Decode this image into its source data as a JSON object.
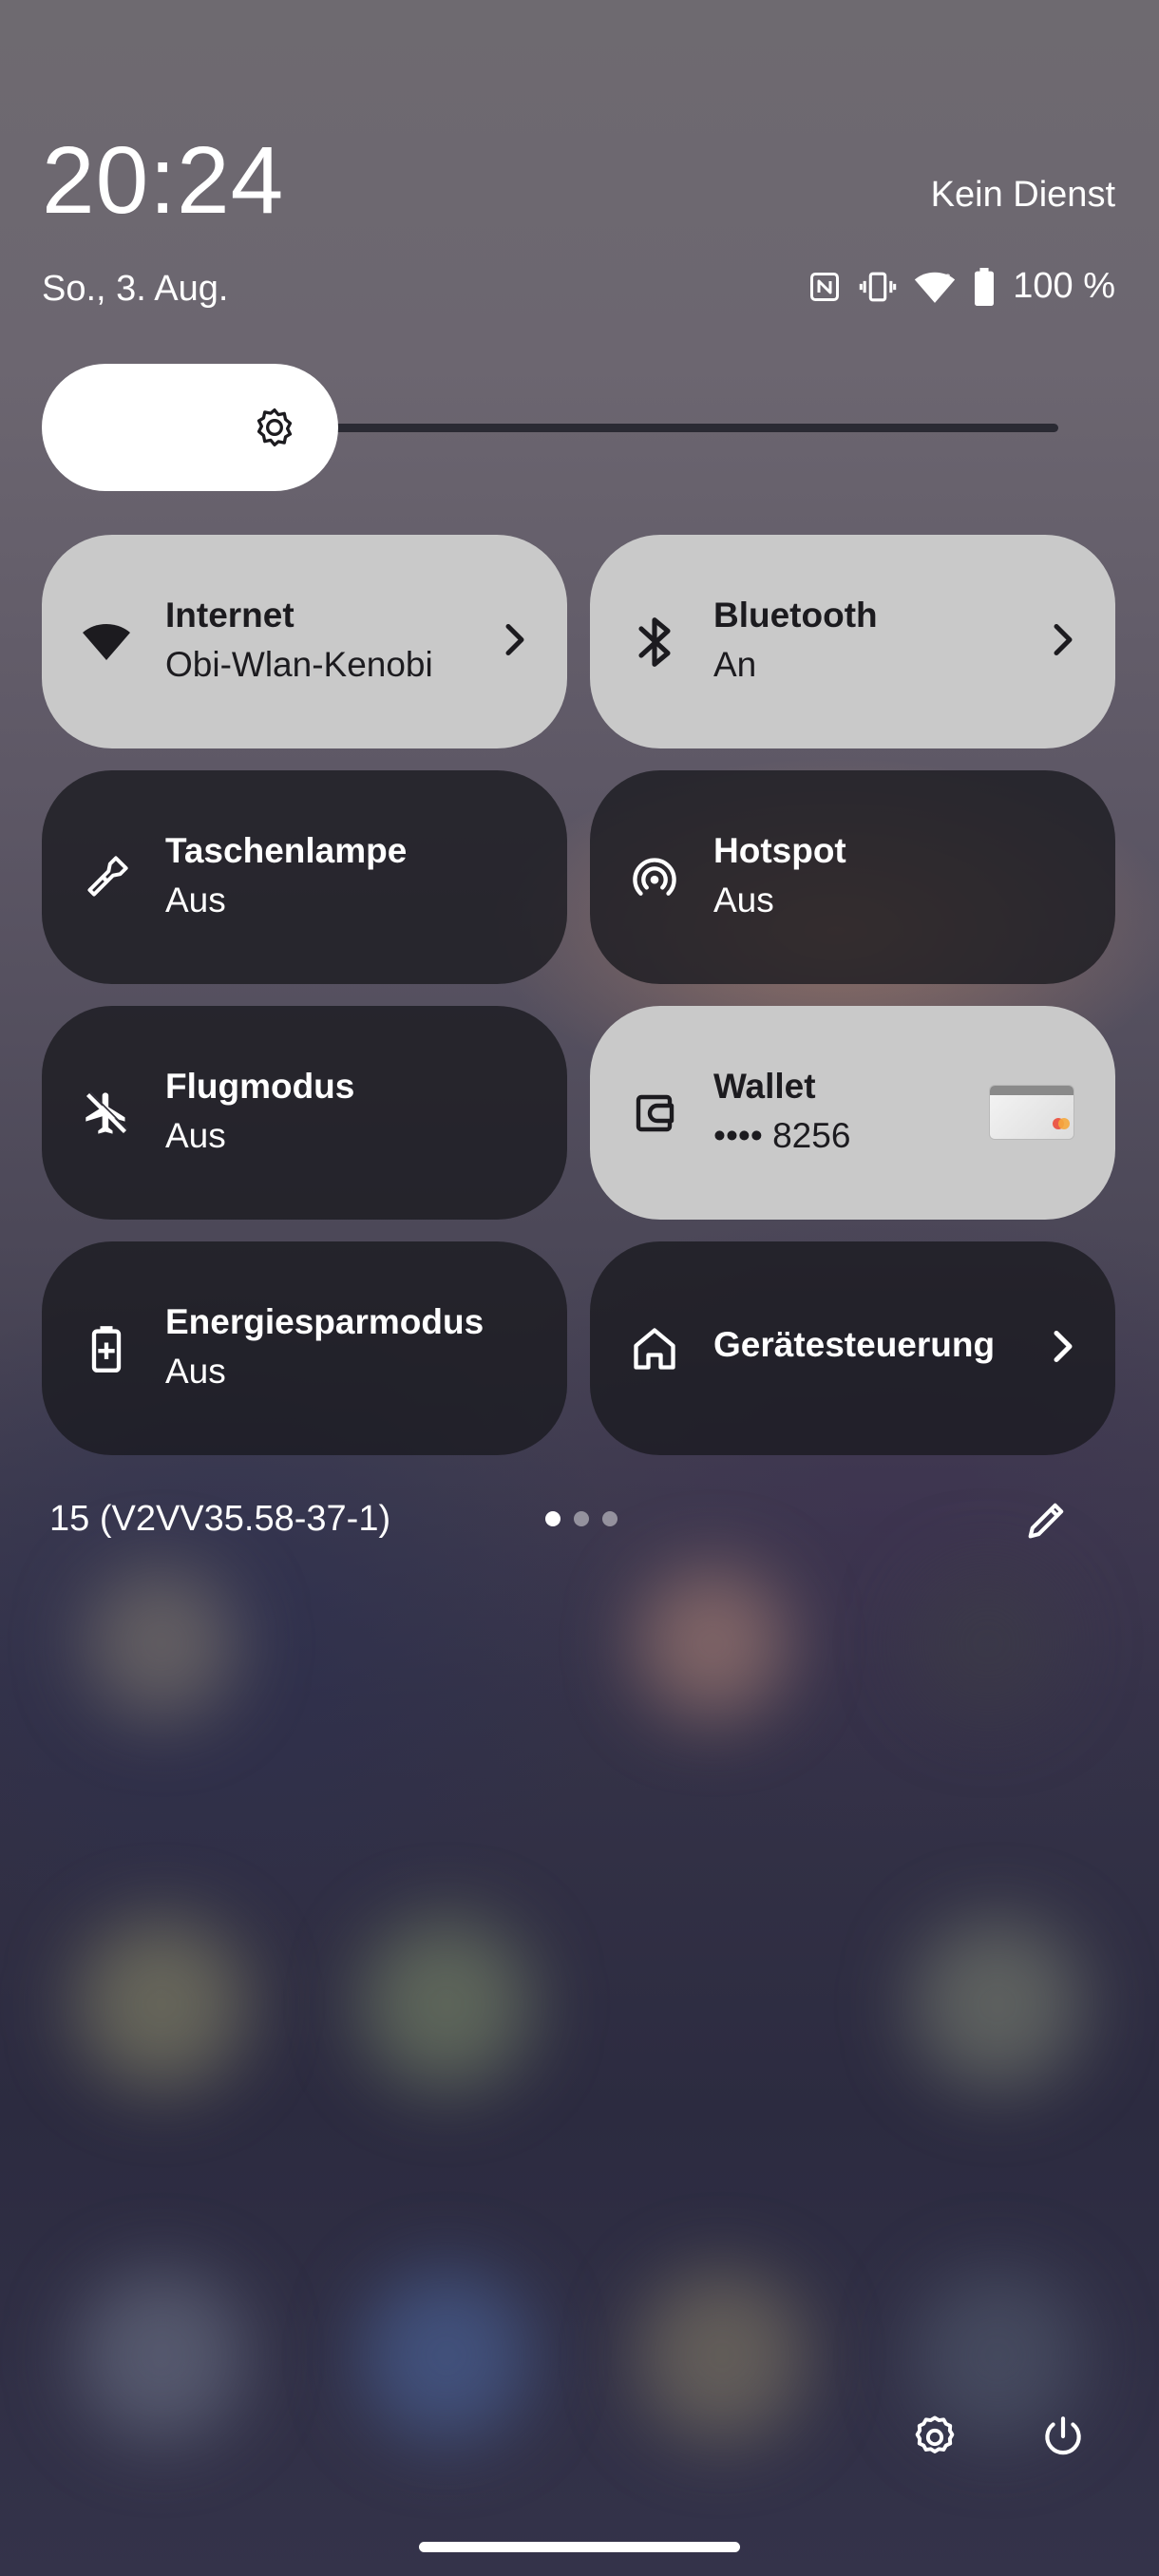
{
  "status_bar": {
    "time": "20:24",
    "carrier": "Kein Dienst",
    "date": "So., 3. Aug.",
    "battery_label": "100 %",
    "icons": [
      "nfc-icon",
      "vibrate-icon",
      "wifi-icon",
      "battery-icon"
    ]
  },
  "brightness": {
    "icon": "brightness-icon",
    "level": 0.28
  },
  "tiles": [
    {
      "title": "Internet",
      "subtitle": "Obi-Wlan-Kenobi",
      "icon": "wifi-icon",
      "state": "on",
      "chevron": true
    },
    {
      "title": "Bluetooth",
      "subtitle": "An",
      "icon": "bluetooth-icon",
      "state": "on",
      "chevron": true
    },
    {
      "title": "Taschenlampe",
      "subtitle": "Aus",
      "icon": "flashlight-icon",
      "state": "off"
    },
    {
      "title": "Hotspot",
      "subtitle": "Aus",
      "icon": "hotspot-icon",
      "state": "off"
    },
    {
      "title": "Flugmodus",
      "subtitle": "Aus",
      "icon": "airplane-off-icon",
      "state": "off"
    },
    {
      "title": "Wallet",
      "subtitle": "•••• 8256",
      "icon": "wallet-icon",
      "state": "on",
      "card_image": true
    },
    {
      "title": "Energiesparmodus",
      "subtitle": "Aus",
      "icon": "battery-saver-icon",
      "state": "off"
    },
    {
      "title": "Gerätesteuerung",
      "icon": "home-icon",
      "state": "off",
      "chevron": true
    }
  ],
  "footer": {
    "build": "15 (V2VV35.58-37-1)",
    "pages": 3,
    "active_page": 1,
    "edit_icon": "edit-icon",
    "settings_icon": "settings-icon",
    "power_icon": "power-icon"
  },
  "colors": {
    "tile_on": "#c9c9c9",
    "tile_off": "#1a191f",
    "text_dark": "#1c1b1f"
  }
}
